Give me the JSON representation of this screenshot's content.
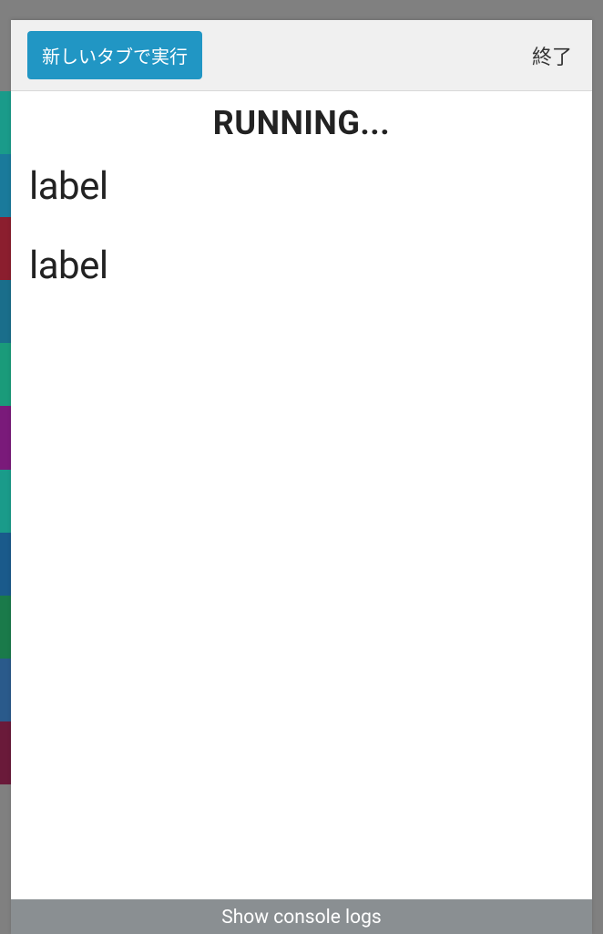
{
  "header": {
    "run_button_label": "新しいタブで実行",
    "close_button_label": "終了"
  },
  "body": {
    "status_title": "RUNNING...",
    "labels": [
      "label",
      "label"
    ]
  },
  "footer": {
    "console_logs_label": "Show console logs"
  },
  "colors": {
    "primary_button": "#2196c4",
    "footer_bg": "#8a8f92"
  }
}
